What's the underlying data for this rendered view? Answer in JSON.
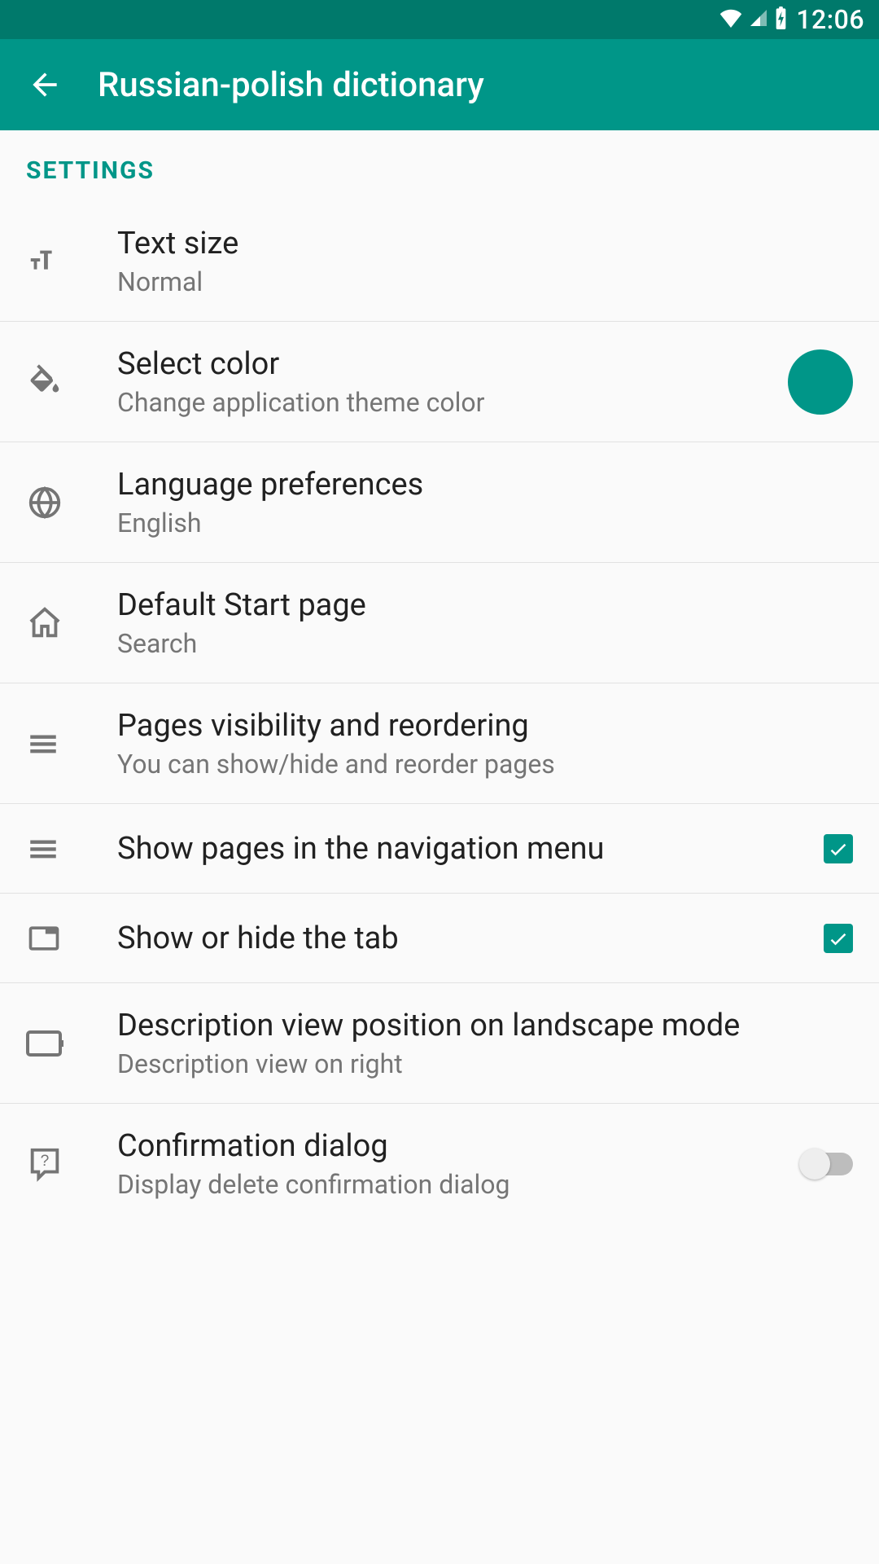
{
  "status": {
    "time": "12:06"
  },
  "header": {
    "title": "Russian-polish dictionary"
  },
  "section_label": "SETTINGS",
  "theme_color": "#009688",
  "items": {
    "text_size": {
      "title": "Text size",
      "sub": "Normal"
    },
    "select_color": {
      "title": "Select color",
      "sub": "Change application theme color"
    },
    "language": {
      "title": "Language preferences",
      "sub": "English"
    },
    "start_page": {
      "title": "Default Start page",
      "sub": "Search"
    },
    "pages_vis": {
      "title": "Pages visibility and reordering",
      "sub": "You can show/hide and reorder pages"
    },
    "show_nav": {
      "title": "Show pages in the navigation menu",
      "checked": true
    },
    "show_tab": {
      "title": "Show or hide the tab",
      "checked": true
    },
    "landscape": {
      "title": "Description view position on landscape mode",
      "sub": "Description view on right"
    },
    "confirm": {
      "title": "Confirmation dialog",
      "sub": "Display delete confirmation dialog",
      "on": false
    }
  }
}
